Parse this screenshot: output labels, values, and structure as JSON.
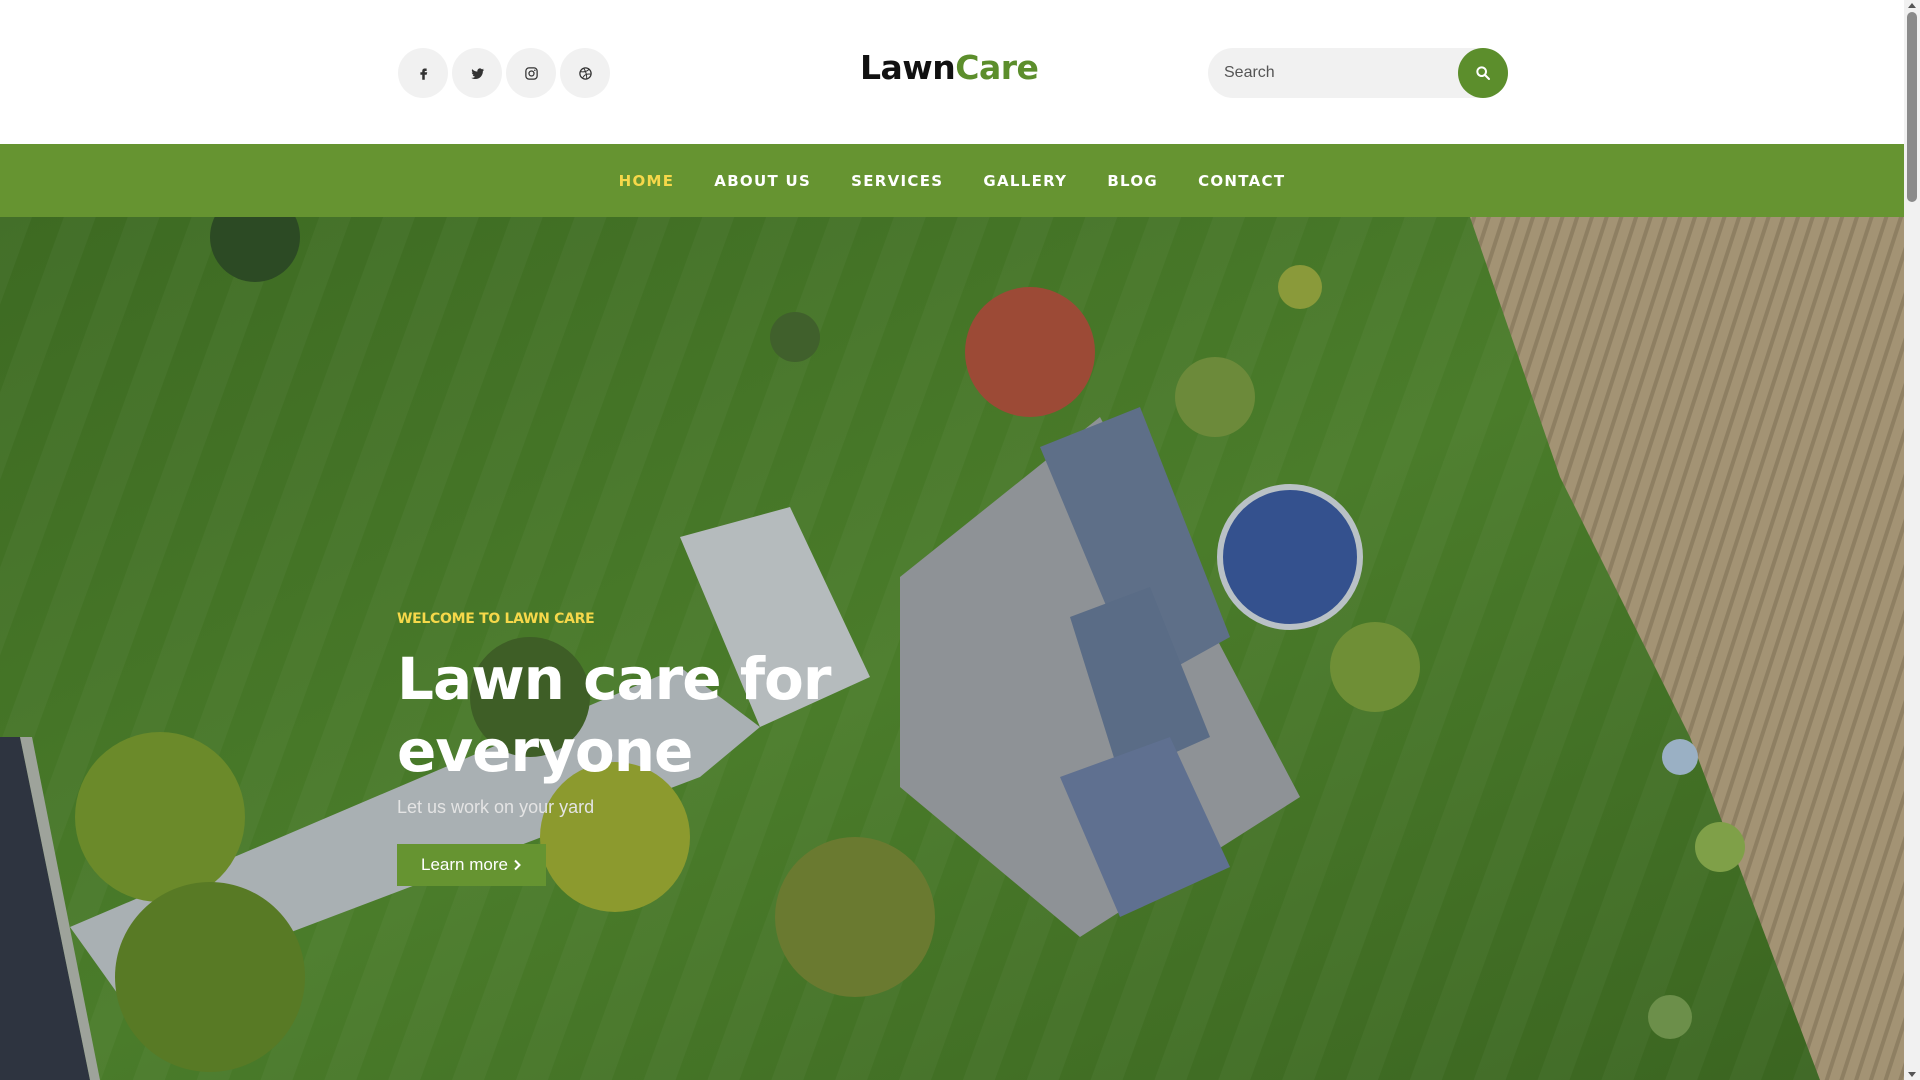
{
  "header": {
    "logo_part1": "Lawn",
    "logo_part2": "Care",
    "search_placeholder": "Search",
    "social": [
      {
        "icon": "facebook-icon"
      },
      {
        "icon": "twitter-icon"
      },
      {
        "icon": "instagram-icon"
      },
      {
        "icon": "dribbble-icon"
      }
    ]
  },
  "nav": {
    "items": [
      {
        "label": "HOME",
        "active": true
      },
      {
        "label": "ABOUT US"
      },
      {
        "label": "SERVICES"
      },
      {
        "label": "GALLERY"
      },
      {
        "label": "BLOG"
      },
      {
        "label": "CONTACT"
      }
    ]
  },
  "hero": {
    "eyebrow": "WELCOME TO LAWN CARE",
    "title": "Lawn care for everyone",
    "subtitle": "Let us work on your yard",
    "button_label": "Learn more",
    "button_icon": "chevron-right-icon"
  },
  "colors": {
    "brand_green": "#669431",
    "accent_yellow": "#f6d84a",
    "logo_dark": "#111111"
  }
}
